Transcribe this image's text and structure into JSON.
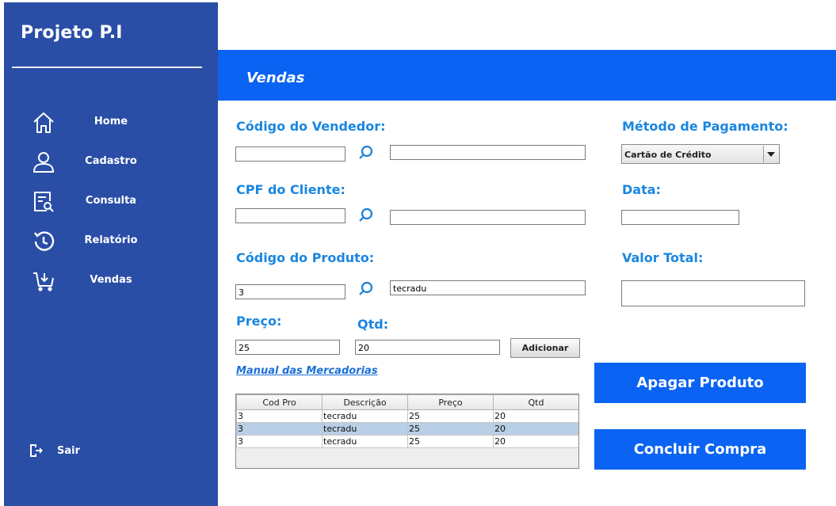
{
  "app": {
    "title": "Projeto P.I"
  },
  "sidebar": {
    "items": [
      {
        "label": "Home",
        "icon": "home-icon"
      },
      {
        "label": "Cadastro",
        "icon": "user-icon"
      },
      {
        "label": "Consulta",
        "icon": "document-search-icon"
      },
      {
        "label": "Relatório",
        "icon": "history-icon"
      },
      {
        "label": "Vendas",
        "icon": "cart-icon"
      }
    ],
    "logout": {
      "label": "Sair",
      "icon": "logout-icon"
    }
  },
  "header": {
    "title": "Vendas"
  },
  "form": {
    "vendedor": {
      "label": "Código do Vendedor:",
      "code": "",
      "name": ""
    },
    "cliente": {
      "label": "CPF do Cliente:",
      "cpf": "",
      "name": ""
    },
    "produto": {
      "label": "Código do Produto:",
      "code": "3",
      "name": "tecradu"
    },
    "preco": {
      "label": "Preço:",
      "value": "25"
    },
    "qtd": {
      "label": "Qtd:",
      "value": "20"
    },
    "add_button": "Adicionar",
    "manual_link": "Manual das Mercadorias",
    "pagamento": {
      "label": "Método de Pagamento:",
      "selected": "Cartão de Crédito"
    },
    "data": {
      "label": "Data:",
      "value": ""
    },
    "valor_total": {
      "label": "Valor Total:",
      "value": ""
    }
  },
  "actions": {
    "apagar": "Apagar Produto",
    "concluir": "Concluir Compra"
  },
  "table": {
    "columns": [
      "Cod Pro",
      "Descrição",
      "Preço",
      "Qtd"
    ],
    "rows": [
      [
        "3",
        "tecradu",
        "25",
        "20"
      ],
      [
        "3",
        "tecradu",
        "25",
        "20"
      ],
      [
        "3",
        "tecradu",
        "25",
        "20"
      ]
    ],
    "selected_row": 1
  },
  "colors": {
    "sidebar": "#2a4ea6",
    "header": "#0a63f2",
    "label": "#1a86e0",
    "selected_row": "#b8cfe6"
  }
}
